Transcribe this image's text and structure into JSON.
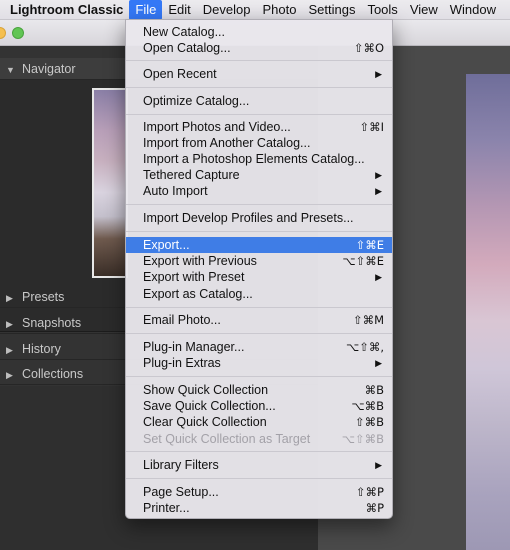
{
  "menubar": {
    "app": "Lightroom Classic",
    "items": [
      "File",
      "Edit",
      "Develop",
      "Photo",
      "Settings",
      "Tools",
      "View",
      "Window"
    ]
  },
  "left_panel": {
    "navigator": "Navigator",
    "presets": "Presets",
    "snapshots": "Snapshots",
    "history": "History",
    "collections": "Collections"
  },
  "file_menu": {
    "new_catalog": {
      "label": "New Catalog..."
    },
    "open_catalog": {
      "label": "Open Catalog...",
      "shortcut": "⇧⌘O"
    },
    "open_recent": {
      "label": "Open Recent",
      "arrow": "▶"
    },
    "optimize_catalog": {
      "label": "Optimize Catalog..."
    },
    "import_photos": {
      "label": "Import Photos and Video...",
      "shortcut": "⇧⌘I"
    },
    "import_catalog": {
      "label": "Import from Another Catalog..."
    },
    "import_pse": {
      "label": "Import a Photoshop Elements Catalog..."
    },
    "tethered_capture": {
      "label": "Tethered Capture",
      "arrow": "▶"
    },
    "auto_import": {
      "label": "Auto Import",
      "arrow": "▶"
    },
    "import_profiles": {
      "label": "Import Develop Profiles and Presets..."
    },
    "export": {
      "label": "Export...",
      "shortcut": "⇧⌘E"
    },
    "export_previous": {
      "label": "Export with Previous",
      "shortcut": "⌥⇧⌘E"
    },
    "export_preset": {
      "label": "Export with Preset",
      "arrow": "▶"
    },
    "export_catalog": {
      "label": "Export as Catalog..."
    },
    "email_photo": {
      "label": "Email Photo...",
      "shortcut": "⇧⌘M"
    },
    "plugin_manager": {
      "label": "Plug-in Manager...",
      "shortcut": "⌥⇧⌘,"
    },
    "plugin_extras": {
      "label": "Plug-in Extras",
      "arrow": "▶"
    },
    "show_quick": {
      "label": "Show Quick Collection",
      "shortcut": "⌘B"
    },
    "save_quick": {
      "label": "Save Quick Collection...",
      "shortcut": "⌥⌘B"
    },
    "clear_quick": {
      "label": "Clear Quick Collection",
      "shortcut": "⇧⌘B"
    },
    "set_quick_target": {
      "label": "Set Quick Collection as Target",
      "shortcut": "⌥⇧⌘B"
    },
    "library_filters": {
      "label": "Library Filters",
      "arrow": "▶"
    },
    "page_setup": {
      "label": "Page Setup...",
      "shortcut": "⇧⌘P"
    },
    "printer": {
      "label": "Printer...",
      "shortcut": "⌘P"
    }
  },
  "colors": {
    "menu_highlight": "#3f7de6",
    "menubar_active": "#3478f6"
  }
}
